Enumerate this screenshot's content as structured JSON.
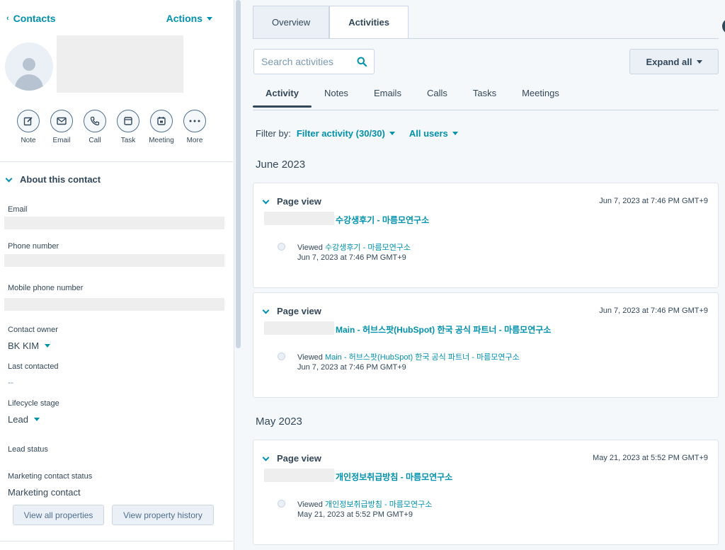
{
  "left": {
    "back_label": "Contacts",
    "actions_label": "Actions",
    "quick_actions": [
      {
        "label": "Note",
        "icon": "pencil-icon"
      },
      {
        "label": "Email",
        "icon": "envelope-icon"
      },
      {
        "label": "Call",
        "icon": "phone-icon"
      },
      {
        "label": "Task",
        "icon": "task-icon"
      },
      {
        "label": "Meeting",
        "icon": "calendar-icon"
      },
      {
        "label": "More",
        "icon": "more-icon"
      }
    ],
    "about_title": "About this contact",
    "fields": {
      "email_label": "Email",
      "phone_label": "Phone number",
      "mobile_label": "Mobile phone number",
      "owner_label": "Contact owner",
      "owner_value": "BK KIM",
      "last_contacted_label": "Last contacted",
      "last_contacted_value": "--",
      "lifecycle_label": "Lifecycle stage",
      "lifecycle_value": "Lead",
      "lead_status_label": "Lead status",
      "marketing_label": "Marketing contact status",
      "marketing_value": "Marketing contact"
    },
    "buttons": {
      "view_all": "View all properties",
      "view_history": "View property history"
    }
  },
  "right": {
    "tabs": [
      "Overview",
      "Activities"
    ],
    "active_tab": "Activities",
    "search_placeholder": "Search activities",
    "expand_label": "Expand all",
    "subtabs": [
      "Activity",
      "Notes",
      "Emails",
      "Calls",
      "Tasks",
      "Meetings"
    ],
    "active_subtab": "Activity",
    "filter_prefix": "Filter by:",
    "filter_activity": "Filter activity (30/30)",
    "filter_users": "All users",
    "months": [
      "June 2023",
      "May 2023"
    ],
    "activities": [
      {
        "type": "Page view",
        "timestamp": "Jun 7, 2023 at 7:46 PM GMT+9",
        "page_title": "수강생후기 - 마름모연구소",
        "viewed_prefix": "Viewed",
        "viewed_link": "수강생후기 - 마름모연구소",
        "viewed_time": "Jun 7, 2023 at 7:46 PM GMT+9"
      },
      {
        "type": "Page view",
        "timestamp": "Jun 7, 2023 at 7:46 PM GMT+9",
        "page_title": "Main - 허브스팟(HubSpot) 한국 공식 파트너 - 마름모연구소",
        "viewed_prefix": "Viewed",
        "viewed_link": "Main - 허브스팟(HubSpot) 한국 공식 파트너 - 마름모연구소",
        "viewed_time": "Jun 7, 2023 at 7:46 PM GMT+9"
      },
      {
        "type": "Page view",
        "timestamp": "May 21, 2023 at 5:52 PM GMT+9",
        "page_title": "개인정보취급방침 - 마름모연구소",
        "viewed_prefix": "Viewed",
        "viewed_link": "개인정보취급방침 - 마름모연구소",
        "viewed_time": "May 21, 2023 at 5:52 PM GMT+9"
      }
    ]
  },
  "colors": {
    "accent": "#0091ae",
    "text": "#33475b",
    "border": "#cbd6e2",
    "panel_bg": "#f5f8fa"
  }
}
